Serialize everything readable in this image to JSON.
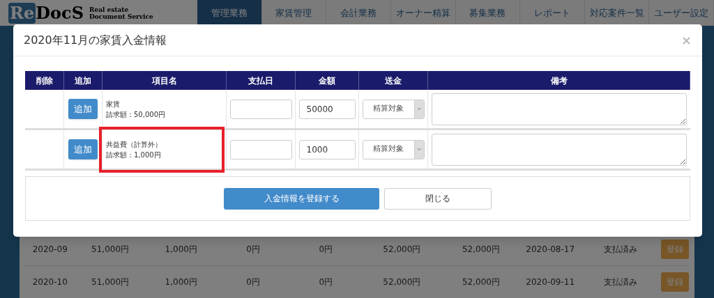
{
  "logo": {
    "mark": "Re",
    "name": "DocS",
    "tagline_1": "Real estate",
    "tagline_2": "Document Service"
  },
  "nav": [
    {
      "label": "管理業務",
      "selected": true
    },
    {
      "label": "家賃管理",
      "selected": false
    },
    {
      "label": "会計業務",
      "selected": false
    },
    {
      "label": "オーナー精算",
      "selected": false
    },
    {
      "label": "募集業務",
      "selected": false
    },
    {
      "label": "レポート",
      "selected": false
    },
    {
      "label": "対応案件一覧",
      "selected": false
    },
    {
      "label": "ユーザー設定",
      "selected": false
    }
  ],
  "background_rows": [
    {
      "cells": [
        "2020-09",
        "51,000円",
        "1,000円",
        "0円",
        "0円",
        "52,000円",
        "52,000円",
        "2020-08-17",
        "支払済み"
      ],
      "action": "登録"
    },
    {
      "cells": [
        "2020-10",
        "51,000円",
        "1,000円",
        "0円",
        "0円",
        "52,000円",
        "52,000円",
        "2020-09-11",
        "支払済み"
      ],
      "action": "登録"
    }
  ],
  "modal": {
    "title": "2020年11月の家賃入金情報",
    "close": "×",
    "columns": [
      "削除",
      "追加",
      "項目名",
      "支払日",
      "金額",
      "送金",
      "備考"
    ],
    "rows": [
      {
        "add_button": "追加",
        "item": "家賃",
        "billed": "請求額：50,000円",
        "amount": "50000",
        "remit": "精算対象",
        "highlighted": false
      },
      {
        "add_button": "追加",
        "item": "共益費（計算外）",
        "billed": "請求額：1,000円",
        "amount": "1000",
        "remit": "精算対象",
        "highlighted": true
      }
    ],
    "buttons": [
      {
        "label": "入金情報を登録する",
        "kind": "primary"
      },
      {
        "label": "閉じる",
        "kind": "default"
      }
    ]
  }
}
